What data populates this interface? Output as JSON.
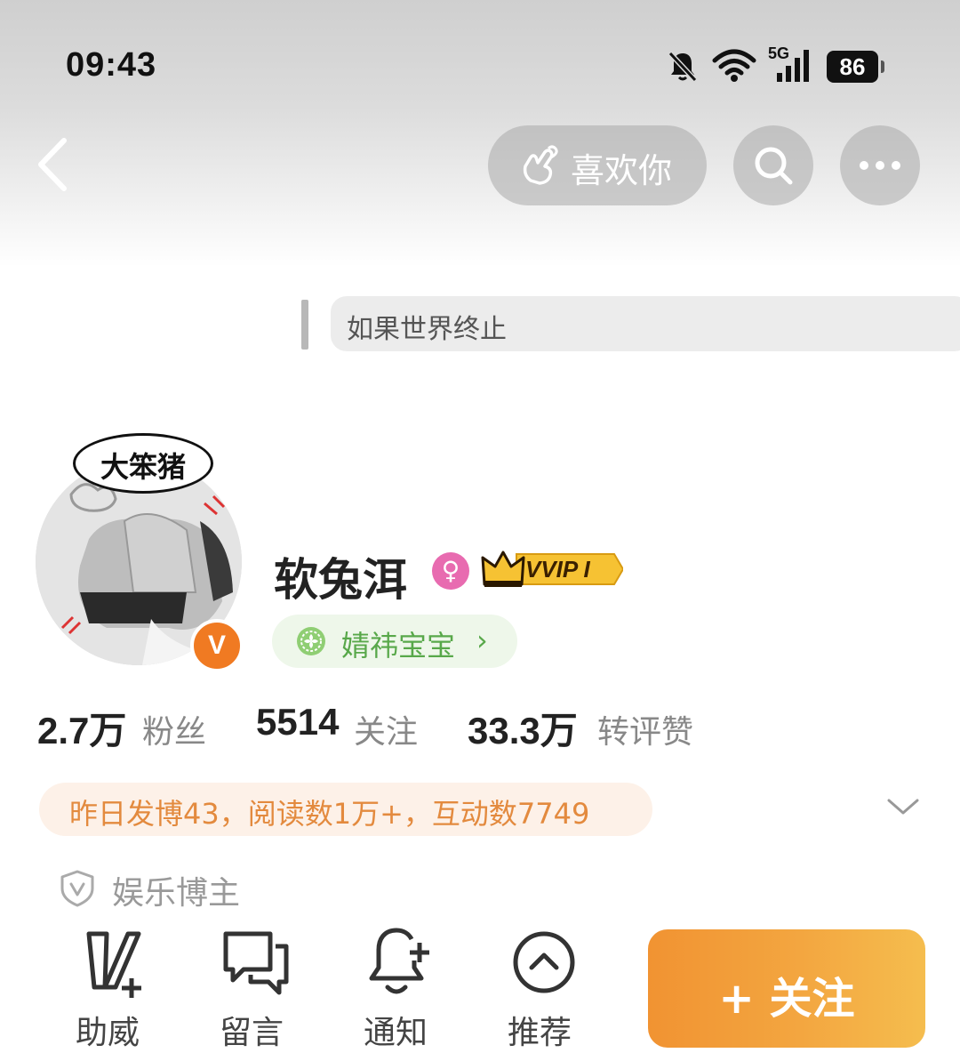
{
  "status_bar": {
    "time": "09:43",
    "network": "5G",
    "battery": "86",
    "icons": [
      "bell-muted-icon",
      "wifi-icon",
      "cellular-signal-icon",
      "battery-icon"
    ]
  },
  "nav": {
    "back_icon": "chevron-left-icon",
    "like_label": "喜欢你",
    "like_icon": "hand-heart-icon",
    "search_icon": "search-icon",
    "more_icon": "more-dots-icon"
  },
  "profile": {
    "signature": "如果世界终止",
    "avatar_bubble_text": "大笨猪",
    "verified_badge": "V",
    "username": "软兔洱",
    "gender_icon": "female-icon",
    "vip_label": "VVIP I",
    "fan_group_label": "婧祎宝宝",
    "fan_group_chevron": "›"
  },
  "stats": [
    {
      "value": "2.7万",
      "label": "粉丝"
    },
    {
      "value": "5514",
      "label": "关注"
    },
    {
      "value": "33.3万",
      "label": "转评赞"
    }
  ],
  "yesterday_summary": "昨日发博43，阅读数1万+，互动数7749",
  "certification": "娱乐博主",
  "actions": [
    {
      "label": "助威",
      "icon": "v-plus-icon"
    },
    {
      "label": "留言",
      "icon": "message-bubbles-icon"
    },
    {
      "label": "通知",
      "icon": "bell-plus-icon"
    },
    {
      "label": "推荐",
      "icon": "chevron-up-circle-icon"
    }
  ],
  "follow_button": "+ 关注",
  "colors": {
    "accent_orange": "#f3a640",
    "fan_green": "#58a84a",
    "summary_orange": "#e38a3e",
    "gender_pink": "#e86bb0"
  }
}
